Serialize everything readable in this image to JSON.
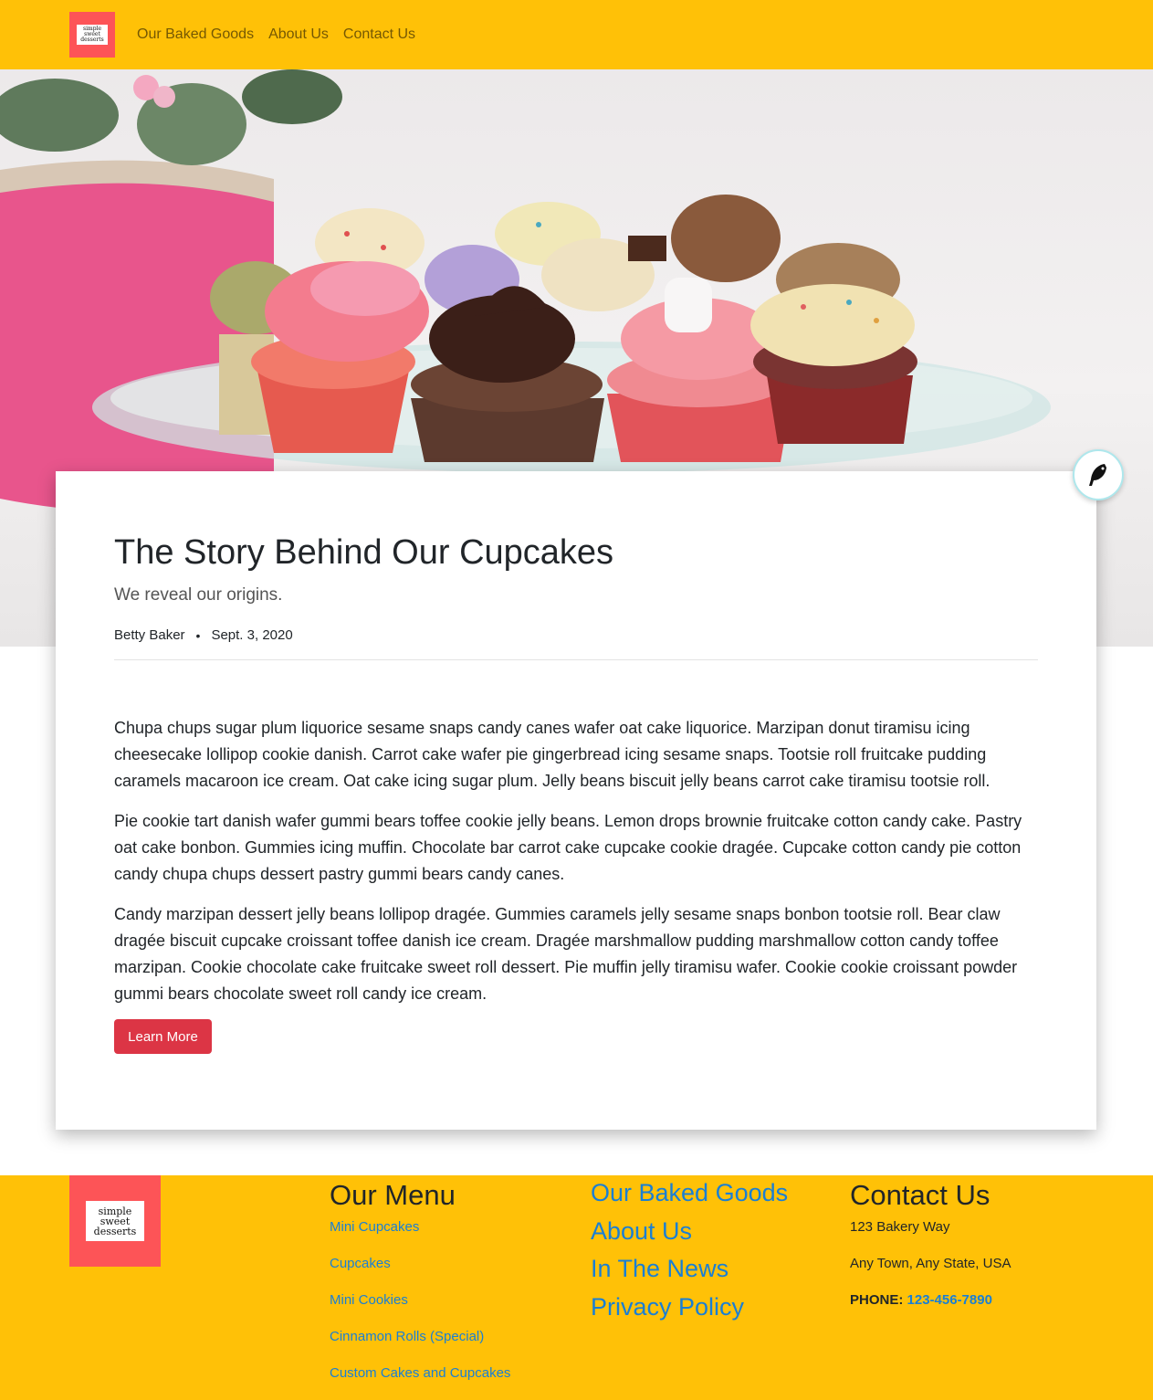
{
  "nav": {
    "logo_lines": [
      "simple",
      "sweet",
      "desserts"
    ],
    "links": [
      "Our Baked Goods",
      "About Us",
      "Contact Us"
    ]
  },
  "post": {
    "title": "The Story Behind Our Cupcakes",
    "subtitle": "We reveal our origins.",
    "author": "Betty Baker",
    "separator": "•",
    "date": "Sept. 3, 2020",
    "paragraphs": [
      "Chupa chups sugar plum liquorice sesame snaps candy canes wafer oat cake liquorice. Marzipan donut tiramisu icing cheesecake lollipop cookie danish. Carrot cake wafer pie gingerbread icing sesame snaps. Tootsie roll fruitcake pudding caramels macaroon ice cream. Oat cake icing sugar plum. Jelly beans biscuit jelly beans carrot cake tiramisu tootsie roll.",
      "Pie cookie tart danish wafer gummi bears toffee cookie jelly beans. Lemon drops brownie fruitcake cotton candy cake. Pastry oat cake bonbon. Gummies icing muffin. Chocolate bar carrot cake cupcake cookie dragée. Cupcake cotton candy pie cotton candy chupa chups dessert pastry gummi bears candy canes.",
      "Candy marzipan dessert jelly beans lollipop dragée. Gummies caramels jelly sesame snaps bonbon tootsie roll. Bear claw dragée biscuit cupcake croissant toffee danish ice cream. Dragée marshmallow pudding marshmallow cotton candy toffee marzipan. Cookie chocolate cake fruitcake sweet roll dessert. Pie muffin jelly tiramisu wafer. Cookie cookie croissant powder gummi bears chocolate sweet roll candy ice cream."
    ],
    "button_label": "Learn More"
  },
  "footer": {
    "logo_lines": [
      "simple",
      "sweet",
      "desserts"
    ],
    "menu_title": "Our Menu",
    "menu_items": [
      "Mini Cupcakes",
      "Cupcakes",
      "Mini Cookies",
      "Cinnamon Rolls (Special)",
      "Custom Cakes and Cupcakes"
    ],
    "links": [
      "Our Baked Goods",
      "About Us",
      "In The News",
      "Privacy Policy"
    ],
    "contact_title": "Contact Us",
    "address_line1": "123 Bakery Way",
    "address_line2": "Any Town, Any State, USA",
    "phone_label": "PHONE:",
    "phone_number": "123-456-7890"
  },
  "colors": {
    "brand_yellow": "#ffc107",
    "logo_red": "#fd5457",
    "button_red": "#dc3545",
    "link_blue": "#1a7fd4"
  },
  "icons": {
    "floating_button": "feather-bird-icon"
  }
}
